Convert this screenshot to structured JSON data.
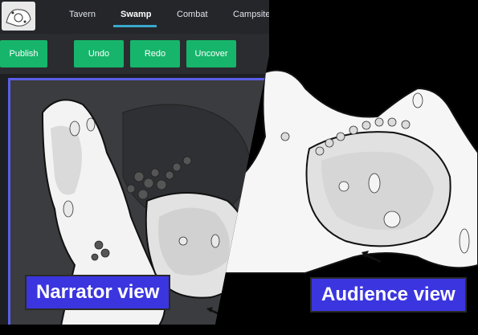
{
  "tabs": [
    {
      "label": "Tavern"
    },
    {
      "label": "Swamp"
    },
    {
      "label": "Combat"
    },
    {
      "label": "Campsite"
    }
  ],
  "toolbar": {
    "publish": "Publish",
    "undo": "Undo",
    "redo": "Redo",
    "uncover": "Uncover"
  },
  "labels": {
    "narrator": "Narrator view",
    "audience": "Audience view"
  },
  "colors": {
    "accent_green": "#16b56b",
    "tab_underline": "#3aa7c9",
    "frame_blue": "#5a5ee8",
    "label_blue": "#3b35e0"
  }
}
